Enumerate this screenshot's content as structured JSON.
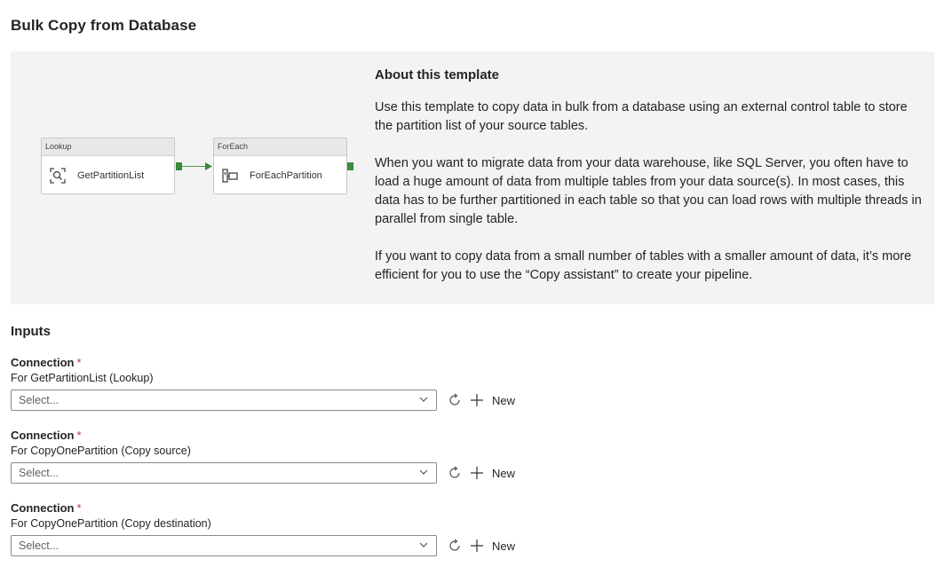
{
  "page": {
    "title": "Bulk Copy from Database"
  },
  "diagram": {
    "activities": [
      {
        "type_label": "Lookup",
        "name": "GetPartitionList",
        "icon": "lookup-icon"
      },
      {
        "type_label": "ForEach",
        "name": "ForEachPartition",
        "icon": "foreach-icon"
      }
    ],
    "colors": {
      "connector": "#3a8a3a"
    }
  },
  "about": {
    "title": "About this template",
    "paragraphs": [
      "Use this template to copy data in bulk from a database using an external control table to store the partition list of your source tables.",
      "When you want to migrate data from your data warehouse, like SQL Server, you often have to load a huge amount of data from multiple tables from your data source(s). In most cases, this data has to be further partitioned in each table so that you can load rows with multiple threads in parallel from single table.",
      "If you want to copy data from a small number of tables with a smaller amount of data, it’s more efficient for you to use the “Copy assistant” to create your pipeline."
    ]
  },
  "inputs": {
    "title": "Inputs",
    "connections": [
      {
        "label": "Connection",
        "required_mark": "*",
        "sublabel": "For GetPartitionList (Lookup)",
        "placeholder": "Select...",
        "new_label": "New"
      },
      {
        "label": "Connection",
        "required_mark": "*",
        "sublabel": "For CopyOnePartition (Copy source)",
        "placeholder": "Select...",
        "new_label": "New"
      },
      {
        "label": "Connection",
        "required_mark": "*",
        "sublabel": "For CopyOnePartition (Copy destination)",
        "placeholder": "Select...",
        "new_label": "New"
      }
    ]
  }
}
